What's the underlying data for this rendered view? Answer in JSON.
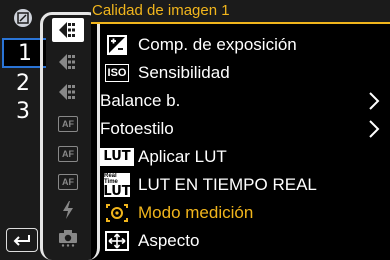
{
  "header": {
    "title": "Calidad de imagen 1"
  },
  "rail": {
    "pages": [
      "1",
      "2",
      "3"
    ],
    "selected_page": "1"
  },
  "menu": {
    "items": [
      {
        "label": "Comp. de exposición",
        "icon": "exposure-compensation-icon"
      },
      {
        "label": "Sensibilidad",
        "icon": "iso-icon",
        "badge": "ISO"
      },
      {
        "label": "Balance b.",
        "has_submenu": true
      },
      {
        "label": "Fotoestilo",
        "has_submenu": true
      },
      {
        "label": "Aplicar LUT",
        "icon": "lut-icon",
        "badge": "LUT"
      },
      {
        "label": "LUT EN TIEMPO REAL",
        "icon": "realtime-lut-icon",
        "badge_small": "Real Time",
        "badge": "LUT"
      },
      {
        "label": "Modo medición",
        "icon": "metering-mode-icon",
        "highlight": true
      },
      {
        "label": "Aspecto",
        "icon": "aspect-ratio-icon"
      }
    ]
  },
  "icon_column": {
    "icons": [
      "photo-quality-icon",
      "photo-quality-icon",
      "photo-quality-icon",
      "af-icon",
      "af-icon",
      "af-icon",
      "flash-icon",
      "camera-icon"
    ],
    "af_label": "AF"
  },
  "colors": {
    "accent": "#f1b51c",
    "selection_blue": "#2a74d6",
    "panel": "#1b1b1b"
  }
}
